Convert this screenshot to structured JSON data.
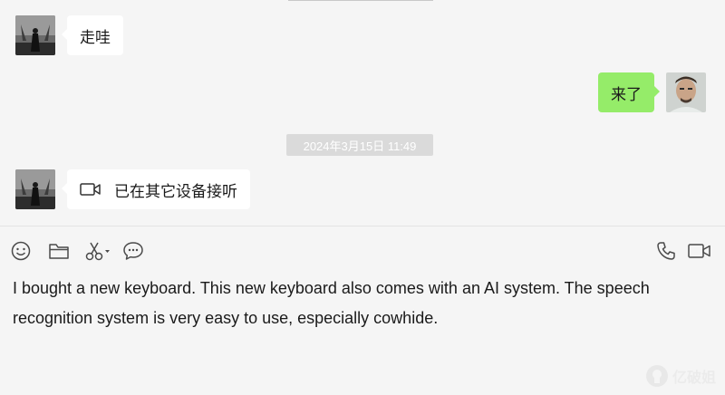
{
  "chat": {
    "messages": [
      {
        "side": "left",
        "text": "走哇"
      },
      {
        "side": "right",
        "text": "来了"
      },
      {
        "side": "left",
        "type": "call",
        "text": "已在其它设备接听"
      }
    ],
    "timestamp": "2024年3月15日 11:49"
  },
  "input": {
    "text": "I bought a new keyboard. This new keyboard also comes with an AI system. The speech recognition system is very easy to use, especially cowhide."
  },
  "toolbar": {
    "left_icons": [
      "emoji-icon",
      "folder-icon",
      "scissors-icon",
      "chat-bubble-icon"
    ],
    "right_icons": [
      "phone-icon",
      "video-icon"
    ]
  },
  "colors": {
    "background": "#f5f5f5",
    "bubble_left": "#ffffff",
    "bubble_right": "#95ec69",
    "timestamp_bg": "#dadada",
    "icon": "#4a4a4a"
  }
}
